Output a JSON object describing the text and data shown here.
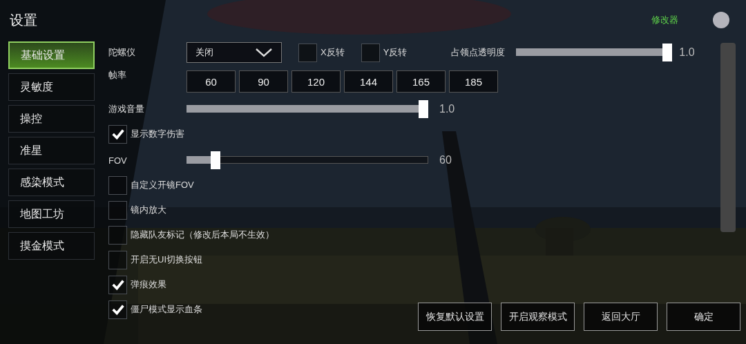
{
  "title": "设置",
  "mod_label": "修改器",
  "sidebar": [
    {
      "label": "基础设置",
      "selected": true
    },
    {
      "label": "灵敏度",
      "selected": false
    },
    {
      "label": "操控",
      "selected": false
    },
    {
      "label": "准星",
      "selected": false
    },
    {
      "label": "感染模式",
      "selected": false
    },
    {
      "label": "地图工坊",
      "selected": false
    },
    {
      "label": "摸金模式",
      "selected": false
    }
  ],
  "gyro": {
    "label": "陀螺仪",
    "value": "关闭"
  },
  "invert": [
    {
      "label": "X反转",
      "checked": false
    },
    {
      "label": "Y反转",
      "checked": false
    }
  ],
  "capture_opacity": {
    "label": "占领点透明度",
    "level": 1,
    "reading": "1.0"
  },
  "frame_rate": {
    "label": "帧率",
    "options": [
      {
        "label": "60",
        "selected": false
      },
      {
        "label": "90",
        "selected": false
      },
      {
        "label": "120",
        "selected": false
      },
      {
        "label": "144",
        "selected": false
      },
      {
        "label": "165",
        "selected": false
      },
      {
        "label": "185",
        "selected": false
      }
    ]
  },
  "volume": {
    "label": "游戏音量",
    "level": 1,
    "reading": "1.0"
  },
  "damage_numbers": {
    "label": "显示数字伤害",
    "checked": true
  },
  "fov": {
    "label": "FOV",
    "level": 0.14,
    "reading": "60"
  },
  "options": [
    {
      "label": "自定义开镜FOV",
      "checked": false
    },
    {
      "label": "镜内放大",
      "checked": false
    },
    {
      "label": "隐藏队友标记（修改后本局不生效）",
      "checked": false
    },
    {
      "label": "开启无UI切换按钮",
      "checked": false
    },
    {
      "label": "弹痕效果",
      "checked": true
    },
    {
      "label": "僵尸模式显示血条",
      "checked": true
    }
  ],
  "buttons": [
    "恢复默认设置",
    "开启观察模式",
    "返回大厅",
    "确定"
  ]
}
